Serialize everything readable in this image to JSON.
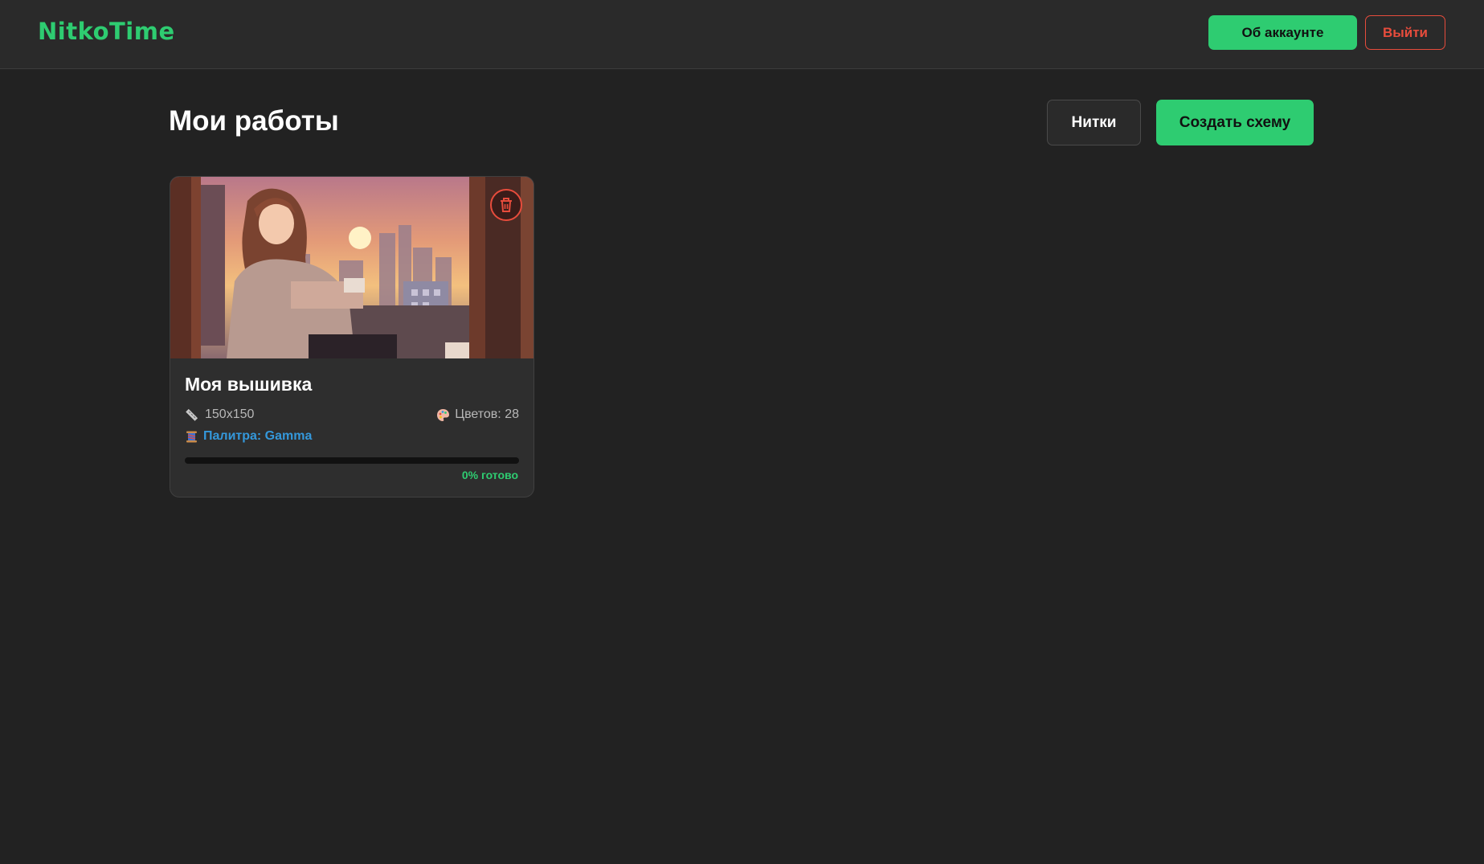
{
  "header": {
    "logo": "NitkoTime",
    "account_label": "Об аккаунте",
    "logout_label": "Выйти"
  },
  "main": {
    "title": "Мои работы",
    "threads_label": "Нитки",
    "create_label": "Создать схему"
  },
  "works": [
    {
      "title": "Моя вышивка",
      "size": "150x150",
      "colors": "Цветов: 28",
      "palette": "Палитра: Gamma",
      "progress": 0,
      "progress_label": "0% готово",
      "icons": {
        "size": "ruler-icon",
        "colors": "palette-icon",
        "palette": "thread-spool-icon",
        "delete": "trash-icon"
      }
    }
  ],
  "colors": {
    "accent": "#2ecc71",
    "danger": "#e74c3c",
    "link": "#3498db",
    "background": "#222222",
    "surface": "#2a2a2a"
  }
}
